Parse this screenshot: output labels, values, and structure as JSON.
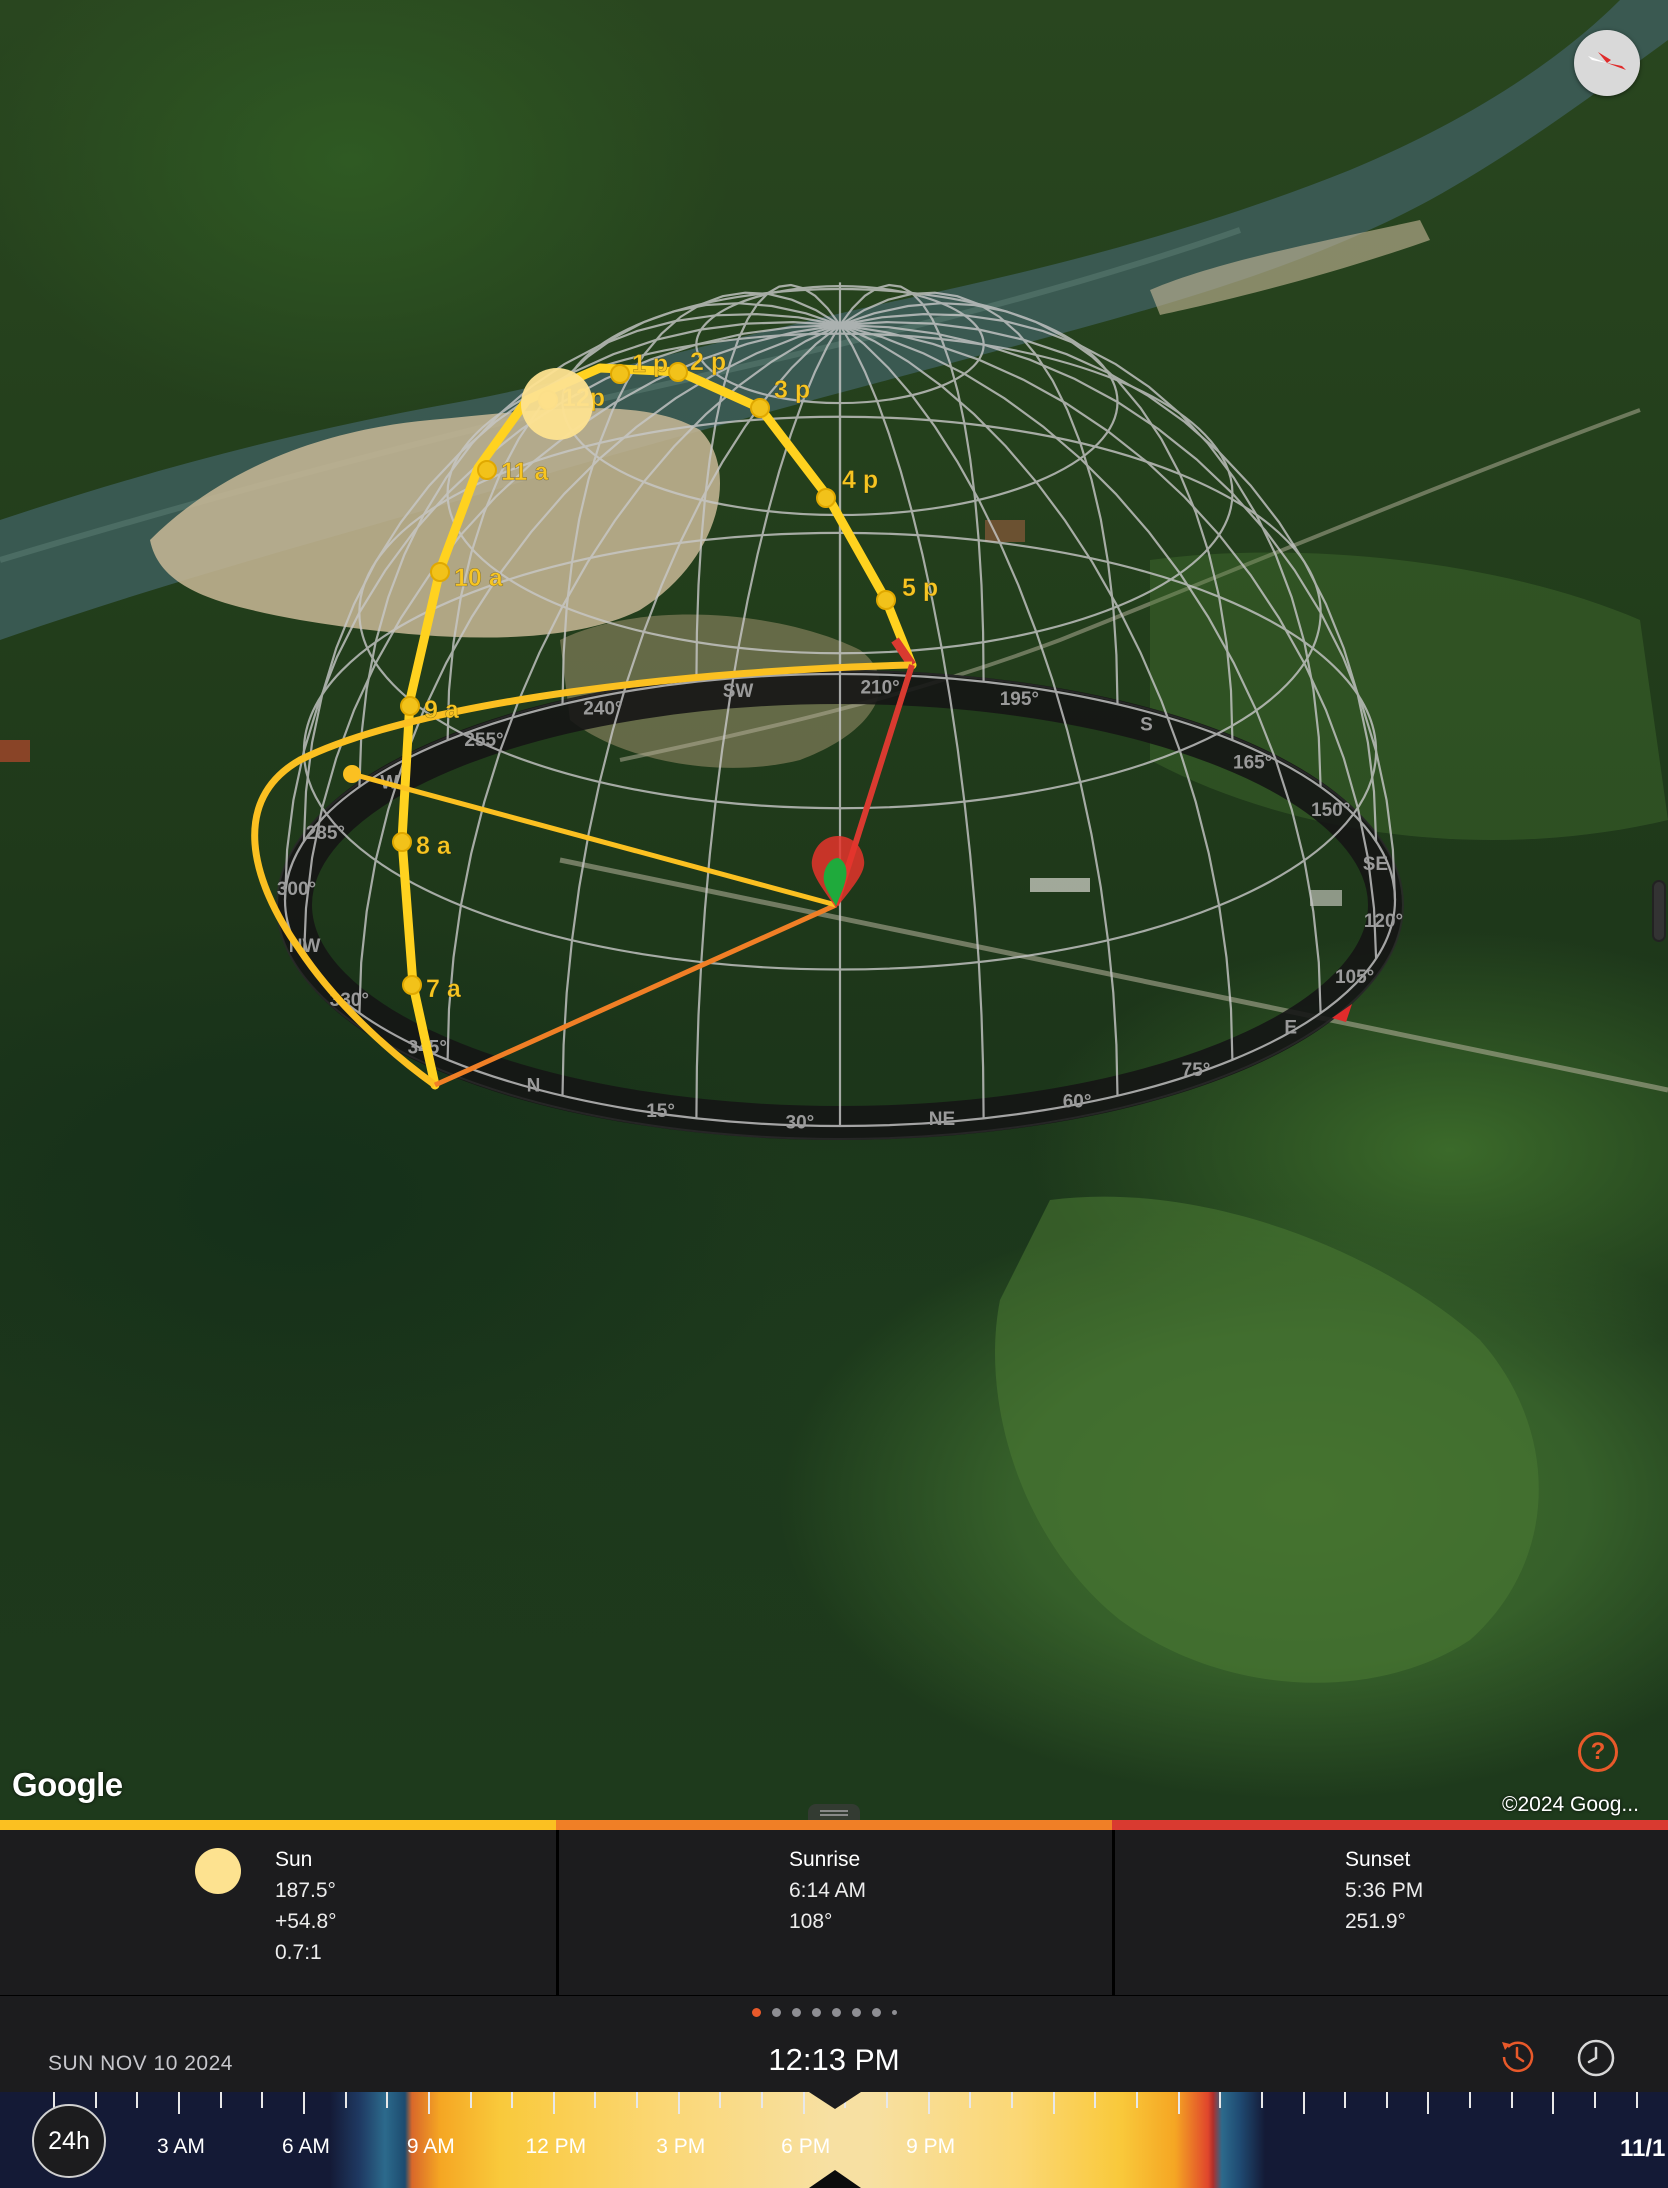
{
  "map": {
    "google_logo": "Google",
    "copyright": "©2024 Goog...",
    "help_label": "?",
    "hour_labels": [
      "7 a",
      "8 a",
      "9 a",
      "10 a",
      "11 a",
      "12p",
      "1 p",
      "2 p",
      "3 p",
      "4 p",
      "5 p"
    ],
    "compass_ring_labels": [
      "240°",
      "SW",
      "210°",
      "195°",
      "S",
      "165°",
      "150°",
      "SE",
      "120°",
      "105°",
      "E",
      "75°",
      "60°",
      "NE",
      "30°",
      "15°",
      "N",
      "345°",
      "330°",
      "NW",
      "300°",
      "285°",
      "W",
      "255°"
    ],
    "colors": {
      "sun_path": "#fbc021",
      "sunrise_line": "#f07f26",
      "sunset_line": "#d93a30",
      "dome_grid": "#c8c8c8"
    }
  },
  "panel": {
    "sun": {
      "title": "Sun",
      "azimuth": "187.5°",
      "elevation": "+54.8°",
      "shadow_ratio": "0.7:1"
    },
    "sunrise": {
      "title": "Sunrise",
      "time": "6:14 AM",
      "azimuth": "108°"
    },
    "sunset": {
      "title": "Sunset",
      "time": "5:36 PM",
      "azimuth": "251.9°"
    }
  },
  "timebar": {
    "date": "SUN NOV 10 2024",
    "time": "12:13",
    "time_ampm": "PM",
    "page_count": 8,
    "active_page": 1
  },
  "timeline": {
    "mode_button": "24h",
    "labels": [
      "3 AM",
      "6 AM",
      "9 AM",
      "12 PM",
      "3 PM",
      "6 PM",
      "9 PM"
    ],
    "end_label": "11/1"
  }
}
